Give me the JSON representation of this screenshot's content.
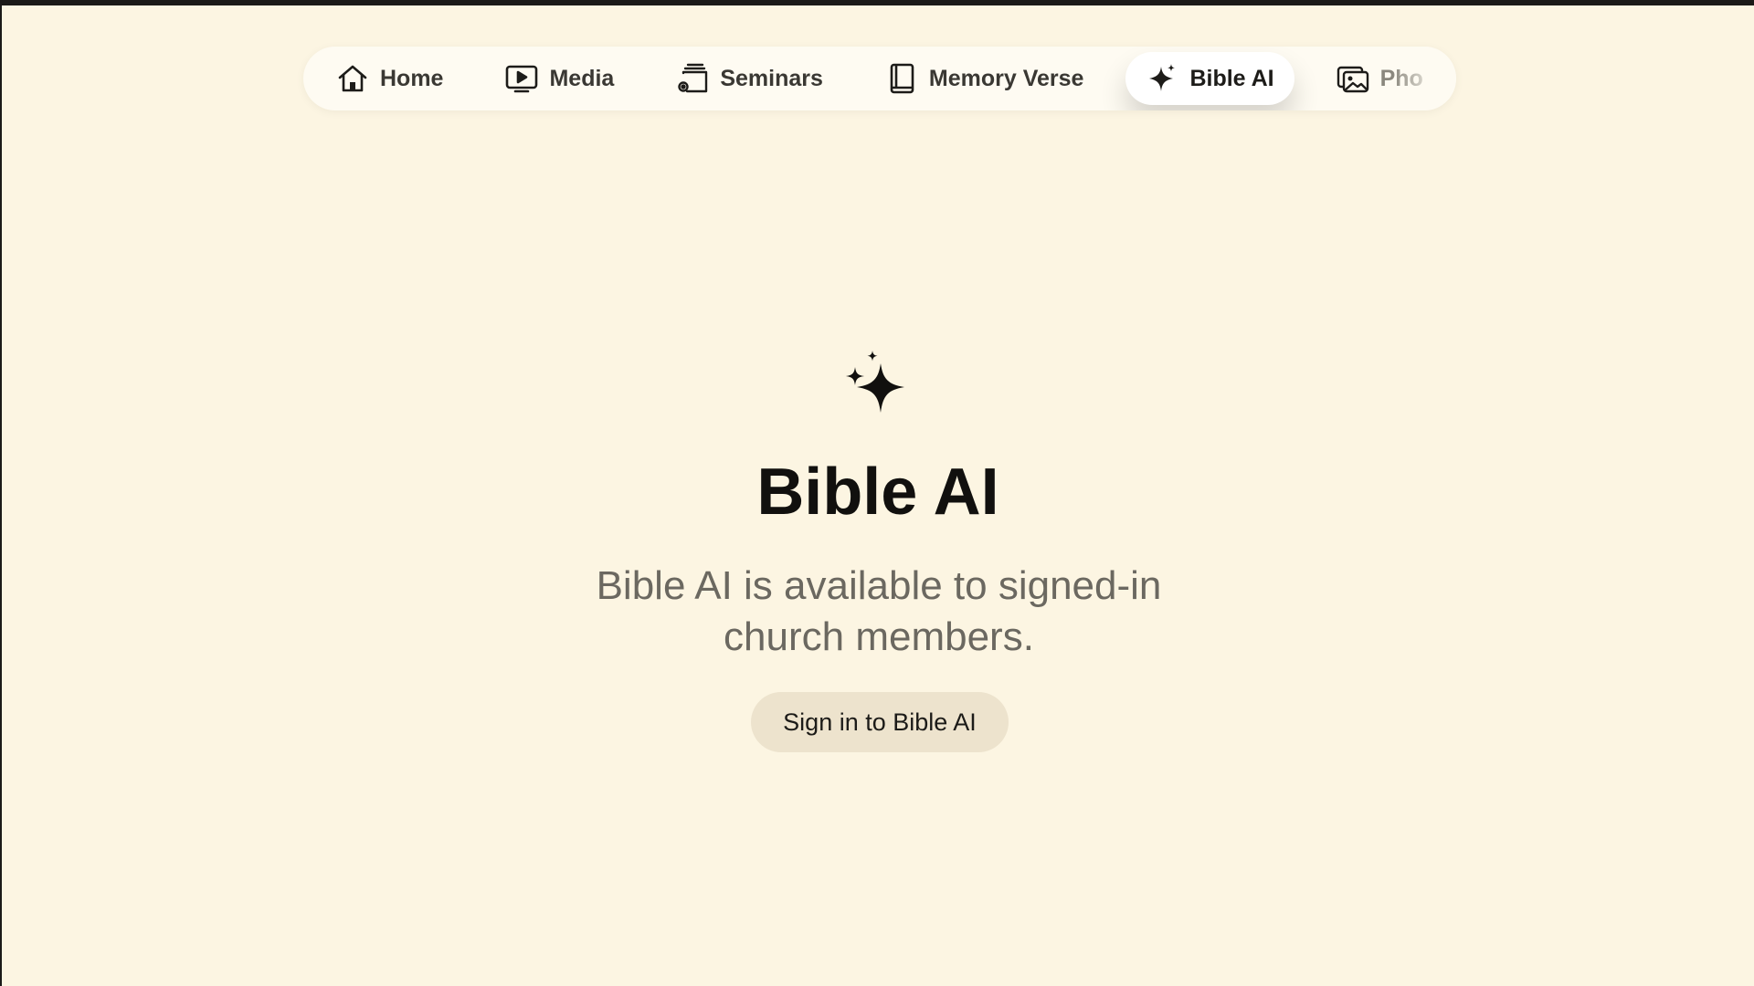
{
  "nav": {
    "items": [
      {
        "label": "Home",
        "icon": "home-icon",
        "active": false
      },
      {
        "label": "Media",
        "icon": "play-icon",
        "active": false
      },
      {
        "label": "Seminars",
        "icon": "seminars-icon",
        "active": false
      },
      {
        "label": "Memory Verse",
        "icon": "book-icon",
        "active": false
      },
      {
        "label": "Bible AI",
        "icon": "sparkle-icon",
        "active": true
      },
      {
        "label": "Pho",
        "icon": "photos-icon",
        "active": false
      }
    ]
  },
  "hero": {
    "icon": "sparkles-icon",
    "title": "Bible AI",
    "subtitle": "Bible AI is available to signed-in church members.",
    "button_label": "Sign in to Bible AI"
  },
  "colors": {
    "background": "#fcf5e2",
    "nav_background": "#fefbf2",
    "button_background": "#ede3cd",
    "title": "#11100e",
    "subtitle": "#6b6860"
  }
}
